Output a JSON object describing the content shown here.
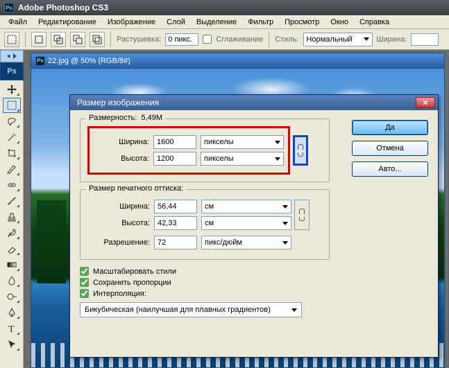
{
  "titlebar": {
    "app_name": "Adobe Photoshop CS3"
  },
  "menu": [
    "Файл",
    "Редактирование",
    "Изображение",
    "Слой",
    "Выделение",
    "Фильтр",
    "Просмотр",
    "Окно",
    "Справка"
  ],
  "optionsbar": {
    "feather_label": "Растушевка:",
    "feather_value": "0 пикс.",
    "antialias_label": "Сглаживание",
    "style_label": "Стиль:",
    "style_value": "Нормальный",
    "width_label": "Ширина:"
  },
  "dock": {
    "ps_label": "Ps"
  },
  "document": {
    "title": "22.jpg @ 50% (RGB/8#)"
  },
  "dialog": {
    "title": "Размер изображения",
    "dimensions_label": "Размерность:",
    "dimensions_value": "5,49M",
    "pixel": {
      "width_label": "Ширина:",
      "width_value": "1600",
      "height_label": "Высота:",
      "height_value": "1200",
      "unit": "пикселы"
    },
    "print": {
      "label": "Размер печатного оттиска:",
      "width_label": "Ширина:",
      "width_value": "56,44",
      "height_label": "Высота:",
      "height_value": "42,33",
      "unit": "см",
      "res_label": "Разрешение:",
      "res_value": "72",
      "res_unit": "пикс/дюйм"
    },
    "checks": {
      "scale_styles": "Масштабировать стили",
      "constrain": "Сохранить пропорции",
      "resample": "Интерполяция:"
    },
    "interp": "Бикубическая (наилучшая для плавных градиентов)",
    "buttons": {
      "ok": "Да",
      "cancel": "Отмена",
      "auto": "Авто..."
    }
  }
}
